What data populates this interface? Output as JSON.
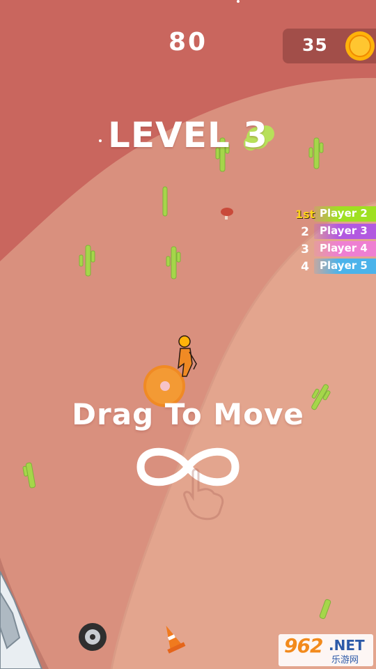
{
  "hud": {
    "score": "80",
    "coins": "35"
  },
  "level": {
    "title": "LEVEL 3"
  },
  "leaderboard": [
    {
      "rank": "1st",
      "name": "Player 2",
      "color": "#9fe021"
    },
    {
      "rank": "2",
      "name": "Player 3",
      "color": "#b259e0"
    },
    {
      "rank": "3",
      "name": "Player 4",
      "color": "#ee7fd2"
    },
    {
      "rank": "4",
      "name": "Player 5",
      "color": "#4bb3ea"
    }
  ],
  "tutorial": {
    "hint": "Drag To Move",
    "gesture_icon": "infinity-icon",
    "hand_icon": "hand-icon"
  },
  "watermark": {
    "number": "962",
    "suffix": ".NET",
    "chinese": "乐游网"
  },
  "colors": {
    "outer_ground": "#c9665e",
    "mid_ground": "#d9907e",
    "inner_ground": "#e3a58e",
    "cactus": "#a5d64a",
    "player": "#f08a24",
    "coin": "#ffb30a"
  }
}
